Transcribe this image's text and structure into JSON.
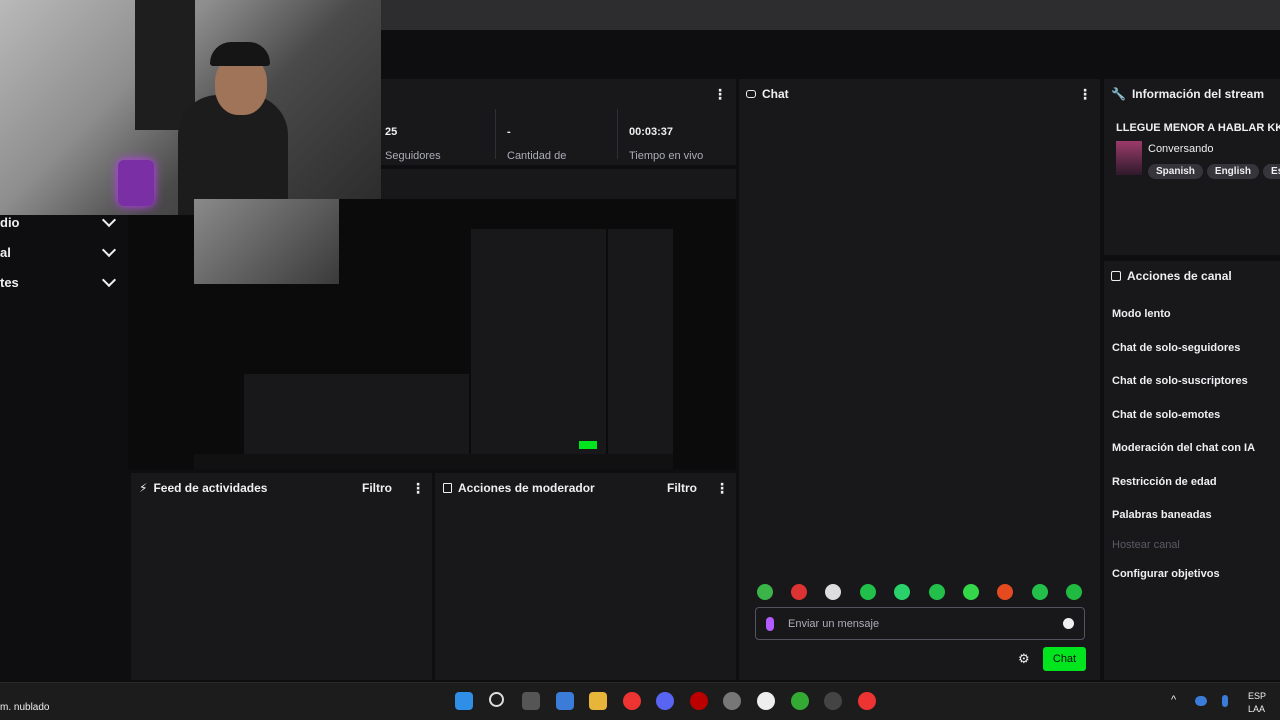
{
  "colors": {
    "accent": "#00e51e",
    "panel": "#18181b",
    "bg": "#0e0e10",
    "muted": "#adadb8"
  },
  "sidebar": {
    "items": [
      {
        "label": "dio"
      },
      {
        "label": "al"
      },
      {
        "label": "tes"
      }
    ]
  },
  "stats": {
    "followers_value": "25",
    "followers_label": "Seguidores",
    "amount_value": "-",
    "amount_label": "Cantidad de",
    "time_value": "00:03:37",
    "time_label": "Tiempo en vivo"
  },
  "chat": {
    "title": "Chat",
    "placeholder": "Enviar un mensaje",
    "send_label": "Chat"
  },
  "stream_info": {
    "title": "Información del stream",
    "stream_title": "LLEGUE MENOR A HABLAR KK",
    "category": "Conversando",
    "tags": [
      "Spanish",
      "English",
      "Espa"
    ]
  },
  "channel_actions": {
    "title": "Acciones de canal",
    "items": [
      {
        "label": "Modo lento",
        "enabled": true
      },
      {
        "label": "Chat de solo-seguidores",
        "enabled": true
      },
      {
        "label": "Chat de solo-suscriptores",
        "enabled": true
      },
      {
        "label": "Chat de solo-emotes",
        "enabled": true
      },
      {
        "label": "Moderación del chat con IA",
        "enabled": true
      },
      {
        "label": "Restricción de edad",
        "enabled": true
      },
      {
        "label": "Palabras baneadas",
        "enabled": true
      },
      {
        "label": "Hostear canal",
        "enabled": false
      },
      {
        "label": "Configurar objetivos",
        "enabled": true
      }
    ]
  },
  "activity_feed": {
    "title": "Feed de actividades",
    "filter": "Filtro"
  },
  "mod_actions": {
    "title": "Acciones de moderador",
    "filter": "Filtro"
  },
  "taskbar": {
    "weather": "m. nublado",
    "lang_top": "ESP",
    "lang_bottom": "LAA",
    "icons": [
      "windows-icon",
      "search-icon",
      "task-view-icon",
      "store-icon",
      "folder-icon",
      "chrome-icon",
      "discord-icon",
      "record-icon",
      "settings-icon",
      "obs-icon",
      "chrome-icon",
      "steam-icon",
      "chrome-icon"
    ]
  }
}
